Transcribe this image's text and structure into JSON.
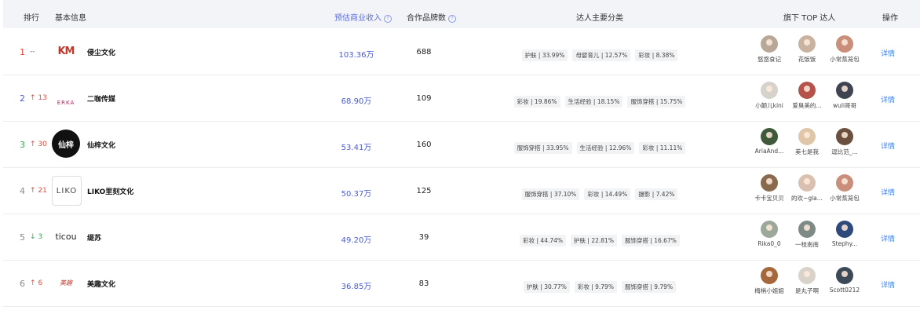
{
  "header": {
    "rank": "排行",
    "basic": "基本信息",
    "income": "预估商业收入",
    "brands": "合作品牌数",
    "categories": "达人主要分类",
    "top": "旗下 TOP 达人",
    "ops": "操作",
    "help_icon": "question-circle-icon"
  },
  "rows": [
    {
      "rank": "1",
      "change": "--",
      "change_dir": "flat",
      "rank_color": "#e8463c",
      "logo": {
        "text": "KM",
        "sub": "侵尘文化",
        "icon": "km-logo-icon"
      },
      "name": "侵尘文化",
      "income": "103.36万",
      "brands": "688",
      "categories": [
        "护肤 | 33.99%",
        "母婴育儿 | 12.57%",
        "彩妆 | 8.38%"
      ],
      "stars": [
        {
          "name": "悠悠食记",
          "color": "#b7a898"
        },
        {
          "name": "花饭饭",
          "color": "#c9b2a0"
        },
        {
          "name": "小常蒸笼包",
          "color": "#c98f7a"
        }
      ],
      "detail": "详情"
    },
    {
      "rank": "2",
      "change": "↑ 13",
      "change_dir": "up",
      "rank_color": "#4a5ad6",
      "logo": {
        "text": "ERKA",
        "sub": "二咖",
        "icon": "erka-logo-icon"
      },
      "name": "二咖传媒",
      "income": "68.90万",
      "brands": "109",
      "categories": [
        "彩妆 | 19.86%",
        "生活经验 | 18.15%",
        "服饰穿搭 | 15.75%"
      ],
      "stars": [
        {
          "name": "小颠儿kini",
          "color": "#d6d2cc"
        },
        {
          "name": "爱臭美的...",
          "color": "#b5524a"
        },
        {
          "name": "wuli哥哥",
          "color": "#3f4450"
        }
      ],
      "detail": "详情"
    },
    {
      "rank": "3",
      "change": "↑ 30",
      "change_dir": "up",
      "rank_color": "#2faa52",
      "logo": {
        "text": "仙梓",
        "sub": "",
        "icon": "xianzi-logo-icon"
      },
      "name": "仙梓文化",
      "income": "53.41万",
      "brands": "160",
      "categories": [
        "服饰穿搭 | 33.95%",
        "生活经验 | 12.96%",
        "彩妆 | 11.11%"
      ],
      "stars": [
        {
          "name": "AriaAnd...",
          "color": "#3e5a3a"
        },
        {
          "name": "美七是我",
          "color": "#e0c6a8"
        },
        {
          "name": "逗比范_...",
          "color": "#6b5040"
        }
      ],
      "detail": "详情"
    },
    {
      "rank": "4",
      "change": "↑ 21",
      "change_dir": "up",
      "rank_color": "#888888",
      "logo": {
        "text": "LIKO",
        "sub": "里刻文化",
        "icon": "liko-logo-icon"
      },
      "name": "LIKO里刻文化",
      "income": "50.37万",
      "brands": "125",
      "categories": [
        "服饰穿搭 | 37.10%",
        "彩妆 | 14.49%",
        "摄影 | 7.42%"
      ],
      "stars": [
        {
          "name": "卡卡宝贝贝",
          "color": "#8a6a4c"
        },
        {
          "name": "的欢~gla...",
          "color": "#d9c0b0"
        },
        {
          "name": "小常蒸笼包",
          "color": "#c98f7a"
        }
      ],
      "detail": "详情"
    },
    {
      "rank": "5",
      "change": "↓ 3",
      "change_dir": "down",
      "rank_color": "#888888",
      "logo": {
        "text": "ticou",
        "sub": "缇苏",
        "icon": "ticou-logo-icon"
      },
      "name": "缇苏",
      "income": "49.20万",
      "brands": "39",
      "categories": [
        "彩妆 | 44.74%",
        "护肤 | 22.81%",
        "服饰穿搭 | 16.67%"
      ],
      "stars": [
        {
          "name": "Rika0_0",
          "color": "#9ba89a"
        },
        {
          "name": "一枝南南",
          "color": "#7d8a86"
        },
        {
          "name": "Stephy...",
          "color": "#2f4a7a"
        }
      ],
      "detail": "详情"
    },
    {
      "rank": "6",
      "change": "↑ 6",
      "change_dir": "up",
      "rank_color": "#888888",
      "logo": {
        "text": "美趣",
        "sub": "",
        "icon": "meiqu-logo-icon"
      },
      "name": "美趣文化",
      "income": "36.85万",
      "brands": "83",
      "categories": [
        "护肤 | 30.77%",
        "彩妆 | 9.79%",
        "服饰穿搭 | 9.79%"
      ],
      "stars": [
        {
          "name": "梅梢小姐姐",
          "color": "#a4683c"
        },
        {
          "name": "是丸子啊",
          "color": "#d8d2ca"
        },
        {
          "name": "Scott0212",
          "color": "#3c4a58"
        }
      ],
      "detail": "详情"
    }
  ]
}
